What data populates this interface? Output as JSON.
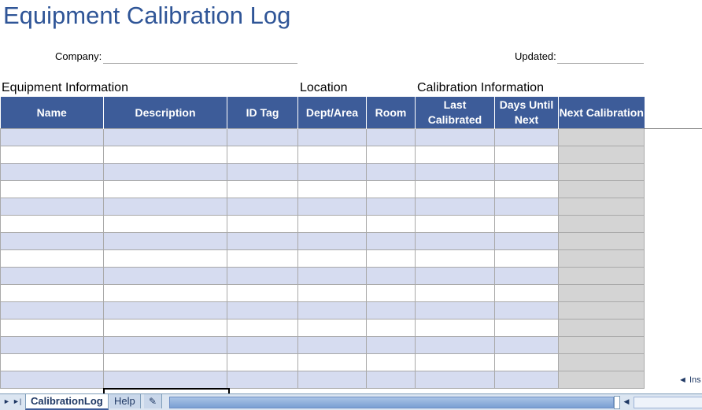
{
  "sheet": {
    "title": "Equipment Calibration Log",
    "company_label": "Company:",
    "updated_label": "Updated:"
  },
  "sections": {
    "equipment": "Equipment Information",
    "location": "Location",
    "calibration": "Calibration Information"
  },
  "columns": [
    {
      "label": "Name"
    },
    {
      "label": "Description"
    },
    {
      "label": "ID Tag"
    },
    {
      "label": "Dept/Area"
    },
    {
      "label": "Room"
    },
    {
      "label": "Last Calibrated"
    },
    {
      "label": "Days Until Next"
    },
    {
      "label": "Next Calibration"
    }
  ],
  "insert_hint": "◄ Ins",
  "tabs": [
    {
      "label": "CalibrationLog",
      "active": true
    },
    {
      "label": "Help",
      "active": false
    }
  ],
  "icons": {
    "nav_next": "tab-scroll-next-icon",
    "nav_last": "tab-scroll-last-icon",
    "new_sheet": "insert-worksheet-icon",
    "scroll_left": "scroll-left-arrow-icon"
  },
  "colors": {
    "title": "#2f5597",
    "header_bg": "#3d5c99",
    "band": "#d6dcf0",
    "calc_col": "#d4d4d4",
    "tabbar": "#dbe5f1"
  }
}
